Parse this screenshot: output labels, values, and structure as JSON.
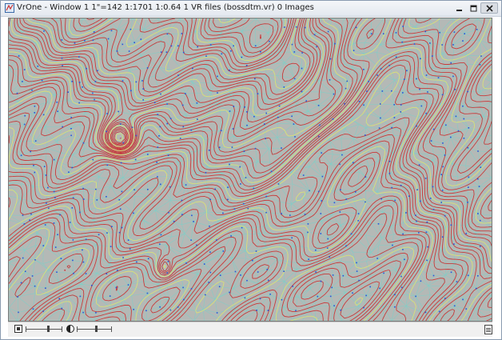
{
  "window": {
    "title": "VrOne - Window 1   1\"=142   1:1701   1:0.64   1 VR files (bossdtm.vr)   0 Images"
  },
  "icons": {
    "app": "vrone-app-icon",
    "minimize": "minimize-icon",
    "maximize": "maximize-icon",
    "close": "close-icon",
    "pan": "pan-box-icon",
    "contrast": "contrast-icon",
    "document": "document-icon"
  },
  "colors": {
    "map_background": "#b4b9b6",
    "tin_edges": "#7ecfc8",
    "contour_major": "#c83a3a",
    "contour_minor": "#d8e07a",
    "spot_points": "#2f4fd8"
  },
  "controls": {
    "zoom_slider_level": 0.6,
    "contrast_slider_level": 0.55
  }
}
